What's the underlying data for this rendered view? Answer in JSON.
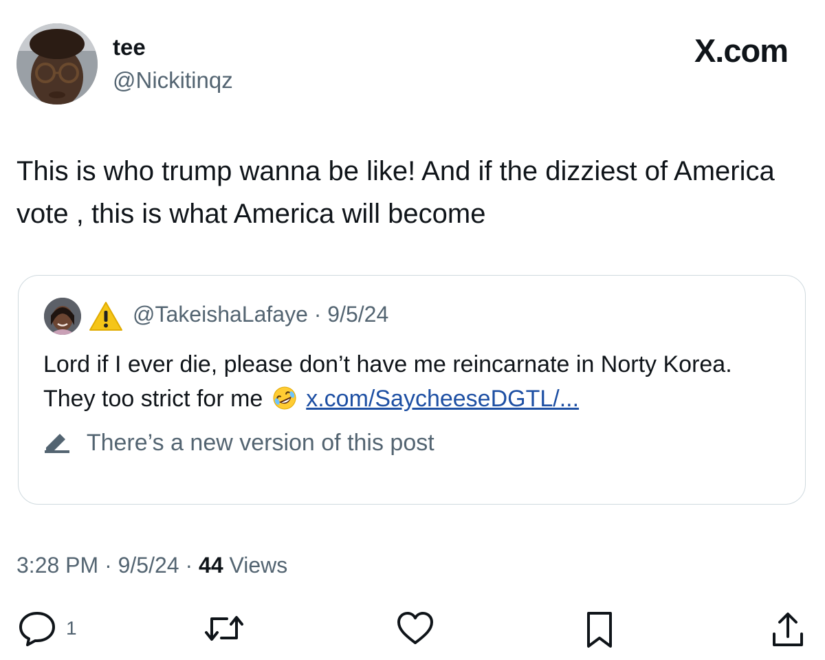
{
  "author": {
    "display_name": "tee",
    "handle": "@Nickitinqz",
    "avatar_icon": "profile-photo-glasses"
  },
  "brand": {
    "label": "X.com"
  },
  "tweet": {
    "text": "This is who trump wanna be like! And if the dizziest of America vote , this is what America will become"
  },
  "quoted_post": {
    "avatar_icon": "profile-photo-woman",
    "warning_icon": "warning-triangle",
    "handle": "@TakeishaLafaye",
    "separator": "·",
    "date": "9/5/24",
    "text_before_emoji": "Lord if I ever die, please don’t have me reincarnate in Norty Korea. They too strict for me",
    "emoji_icon": "rolling-on-floor-laughing-emoji",
    "link_text": "x.com/SaycheeseDGTL/...",
    "edit_notice": "There’s a new version of this post",
    "edit_icon": "pencil-icon"
  },
  "meta": {
    "time": "3:28 PM",
    "sep1": "·",
    "date": "9/5/24",
    "sep2": "·",
    "views_count": "44",
    "views_label": "Views"
  },
  "actions": {
    "reply_count": "1",
    "icons": [
      "reply-icon",
      "retweet-icon",
      "like-icon",
      "bookmark-icon",
      "share-icon"
    ]
  },
  "colors": {
    "text_primary": "#0f1419",
    "text_secondary": "#536471",
    "border": "#cfd9de",
    "link": "#1d4fa3",
    "warning": "#f5c518"
  }
}
